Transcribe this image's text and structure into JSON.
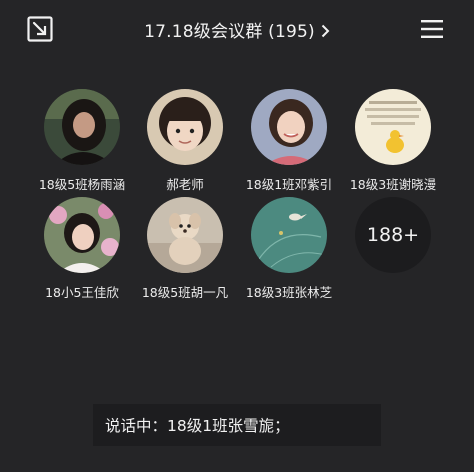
{
  "header": {
    "title": "17.18级会议群 (195)",
    "shrink_icon": "shrink-window-icon",
    "menu_icon": "hamburger-menu-icon"
  },
  "members": [
    {
      "name": "18级5班杨雨涵",
      "avatar": "photo-girl-dark-hair"
    },
    {
      "name": "郝老师",
      "avatar": "photo-child-bangs"
    },
    {
      "name": "18级1班邓紫引",
      "avatar": "photo-girl-smiling"
    },
    {
      "name": "18级3班谢晓漫",
      "avatar": "illustration-duck-text"
    },
    {
      "name": "18小5王佳欣",
      "avatar": "photo-girl-flowers"
    },
    {
      "name": "18级5班胡一凡",
      "avatar": "photo-puppy"
    },
    {
      "name": "18级3班张林芝",
      "avatar": "illustration-teal-bird"
    }
  ],
  "more_count": "188+",
  "speaking": {
    "text": "说话中：18级1班张雪旎；"
  },
  "colors": {
    "background": "#252527",
    "panel": "#1d1d1f",
    "text": "#f2f2f2"
  }
}
